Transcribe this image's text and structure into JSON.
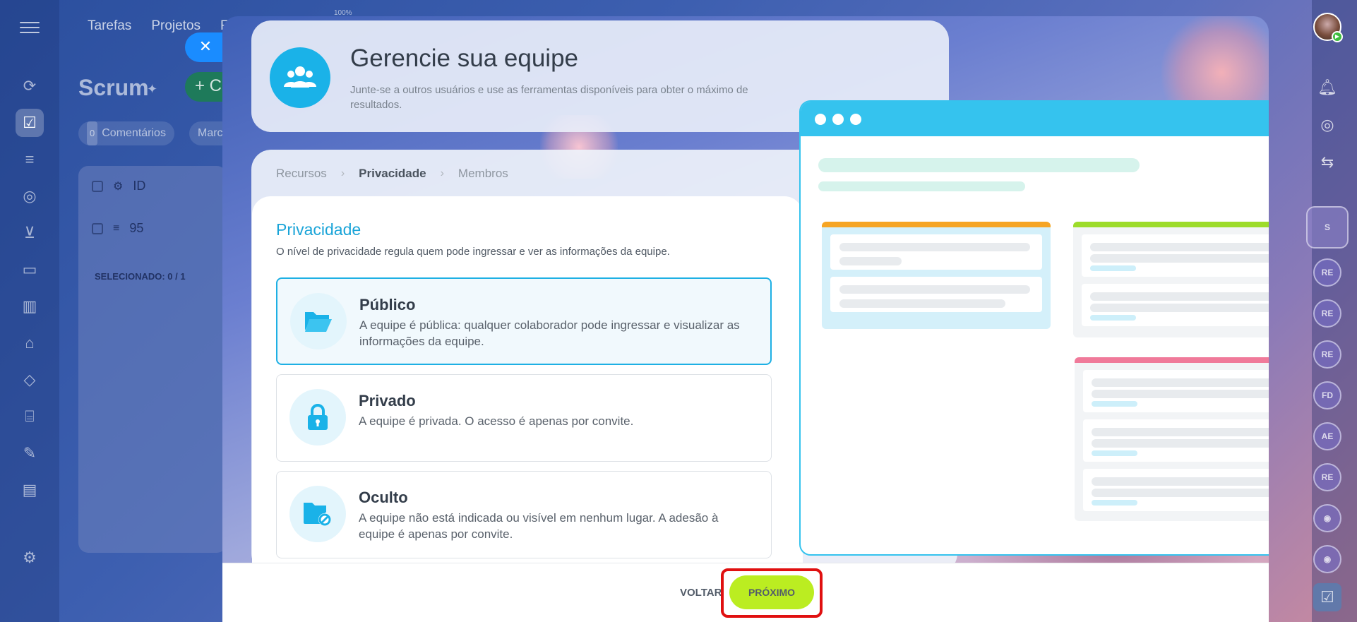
{
  "background": {
    "nav": [
      "Tarefas",
      "Projetos",
      "F"
    ],
    "zoom": "100%",
    "title": "Scrum",
    "add_button": "+ C",
    "chips": [
      {
        "count": "0",
        "label": "Comentários"
      },
      {
        "label": "Marcar"
      }
    ],
    "table": {
      "header": "ID",
      "row_id": "95",
      "selected_label": "SELECIONADO:",
      "selected_value": "0 / 1"
    },
    "right_rail_users": [
      "S",
      "RE",
      "RE",
      "RE",
      "FD",
      "AE",
      "RE"
    ]
  },
  "hero": {
    "title": "Gerencie sua equipe",
    "subtitle": "Junte-se a outros usuários e use as ferramentas disponíveis para obter o máximo de resultados."
  },
  "steps": [
    {
      "label": "Recursos",
      "current": false
    },
    {
      "label": "Privacidade",
      "current": true
    },
    {
      "label": "Membros",
      "current": false
    }
  ],
  "privacy": {
    "title": "Privacidade",
    "description": "O nível de privacidade regula quem pode ingressar e ver as informações da equipe.",
    "options": [
      {
        "icon": "folder-open-icon",
        "title": "Público",
        "description": "A equipe é pública: qualquer colaborador pode ingressar e visualizar as informações da equipe.",
        "selected": true
      },
      {
        "icon": "lock-icon",
        "title": "Privado",
        "description": "A equipe é privada. O acesso é apenas por convite.",
        "selected": false
      },
      {
        "icon": "hidden-folder-icon",
        "title": "Oculto",
        "description": "A equipe não está indicada ou visível em nenhum lugar. A adesão à equipe é apenas por convite.",
        "selected": false
      }
    ]
  },
  "footer": {
    "back": "VOLTAR",
    "next": "PRÓXIMO"
  },
  "colors": {
    "accent": "#1eb0e4",
    "next_button": "#bbed21",
    "highlight": "#e01010"
  }
}
